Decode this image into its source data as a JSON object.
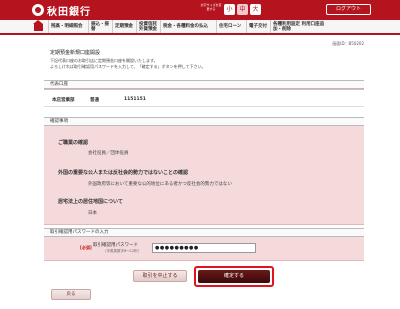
{
  "header": {
    "bank_name": "秋田銀行",
    "font_size_label": "文字サイズを変更する",
    "font_sizes": [
      "小",
      "中",
      "大"
    ],
    "logout_label": "ログアウト"
  },
  "nav": {
    "items": [
      "残高・明細照会",
      "振込・振替",
      "定期預金",
      "投資信託 外貨預金",
      "税金・各種料金の払込",
      "住宅ローン",
      "電子交付",
      "各種利用設定 利用口座追加・削除"
    ]
  },
  "page": {
    "screen_number": "画面ID：B50202",
    "title": "定期預金新規口座開設",
    "description_line1": "下記代表口座のお取引店に定期預金口座を開設いたします。",
    "description_line2": "よろしければ取引確認用パスワードを入力して、「確定する」ボタンを押して下さい。"
  },
  "account_section": {
    "heading": "代表口座",
    "branch": "本店営業部",
    "type": "普通",
    "number": "1151151"
  },
  "confirm_section": {
    "heading": "確認事項",
    "items": [
      {
        "title": "ご職業の確認",
        "value": "会社役員／団体役員"
      },
      {
        "title": "外国の重要な公人または反社会的勢力ではないことの確認",
        "value": "外国政府等において重要な公的地位にある者かつ反社会的勢力ではない"
      },
      {
        "title": "居宅法上の居住地国について",
        "value": "日本"
      }
    ]
  },
  "password_section": {
    "heading": "取引確認用パスワードの入力",
    "required_label": "[必須]",
    "field_label": "取引確認用パスワード",
    "field_hint": "（半角英数字6〜12桁）",
    "field_value": "●●●●●●●●●"
  },
  "buttons": {
    "cancel_label": "取引を中止する",
    "confirm_label": "確定する",
    "back_label": "戻る"
  },
  "colors": {
    "brand": "#b5141e",
    "pink_panel": "#f4dada",
    "confirm_button": "#4a0d0d"
  }
}
